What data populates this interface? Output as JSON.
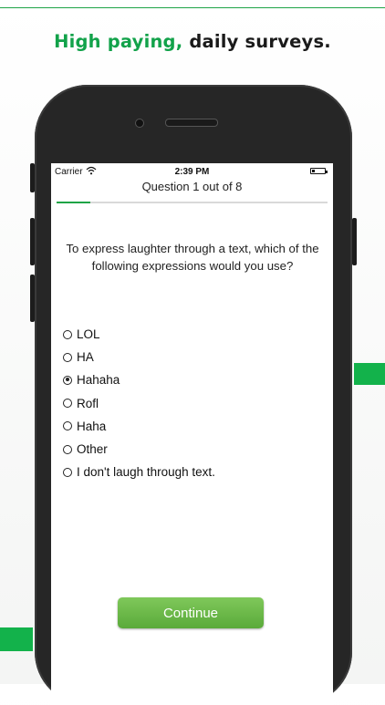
{
  "headline": {
    "accent": "High paying,",
    "rest": " daily surveys."
  },
  "status_bar": {
    "carrier": "Carrier",
    "time": "2:39 PM"
  },
  "survey": {
    "progress_label": "Question 1 out of 8",
    "progress_fraction": 0.125,
    "question": "To express laughter through a text, which of the following expressions would you use?",
    "options": [
      {
        "label": "LOL",
        "selected": false
      },
      {
        "label": "HA",
        "selected": false
      },
      {
        "label": "Hahaha",
        "selected": true
      },
      {
        "label": "Rofl",
        "selected": false
      },
      {
        "label": "Haha",
        "selected": false
      },
      {
        "label": "Other",
        "selected": false
      },
      {
        "label": "I don't laugh through text.",
        "selected": false
      }
    ],
    "continue_label": "Continue"
  },
  "colors": {
    "brand_green": "#12a24a",
    "button_green": "#6cb84a"
  }
}
